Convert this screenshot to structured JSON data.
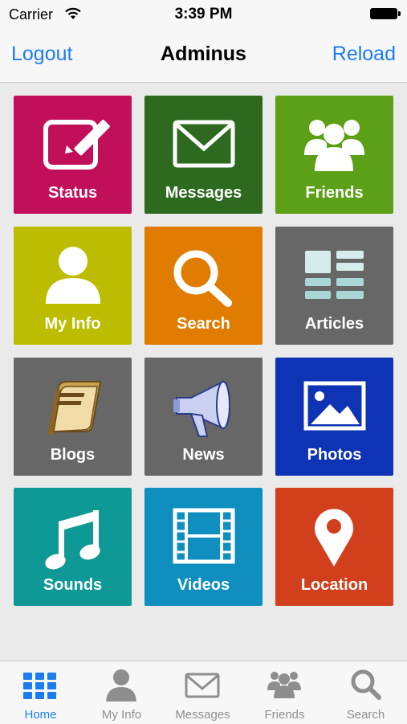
{
  "status_bar": {
    "carrier": "Carrier",
    "time": "3:39 PM"
  },
  "nav": {
    "left_button": "Logout",
    "title": "Adminus",
    "right_button": "Reload"
  },
  "tiles": [
    {
      "label": "Status",
      "icon": "edit-icon",
      "color": "#c20f5a"
    },
    {
      "label": "Messages",
      "icon": "envelope-icon",
      "color": "#2d6a1f"
    },
    {
      "label": "Friends",
      "icon": "group-icon",
      "color": "#5ba016"
    },
    {
      "label": "My Info",
      "icon": "user-icon",
      "color": "#bcbd00"
    },
    {
      "label": "Search",
      "icon": "magnifier-icon",
      "color": "#e07c00"
    },
    {
      "label": "Articles",
      "icon": "articles-icon",
      "color": "#676767"
    },
    {
      "label": "Blogs",
      "icon": "book-icon",
      "color": "#676767"
    },
    {
      "label": "News",
      "icon": "megaphone-icon",
      "color": "#676767"
    },
    {
      "label": "Photos",
      "icon": "picture-icon",
      "color": "#0e33b5"
    },
    {
      "label": "Sounds",
      "icon": "music-note-icon",
      "color": "#0f9996"
    },
    {
      "label": "Videos",
      "icon": "film-icon",
      "color": "#0e8fc0"
    },
    {
      "label": "Location",
      "icon": "map-pin-icon",
      "color": "#d23f1c"
    }
  ],
  "tab_bar": {
    "items": [
      {
        "label": "Home",
        "icon": "grid-icon",
        "active": true
      },
      {
        "label": "My Info",
        "icon": "user-icon",
        "active": false
      },
      {
        "label": "Messages",
        "icon": "envelope-icon",
        "active": false
      },
      {
        "label": "Friends",
        "icon": "group-icon",
        "active": false
      },
      {
        "label": "Search",
        "icon": "magnifier-icon",
        "active": false
      }
    ],
    "active_color": "#1b7cf2",
    "inactive_color": "#8e8e8e"
  }
}
